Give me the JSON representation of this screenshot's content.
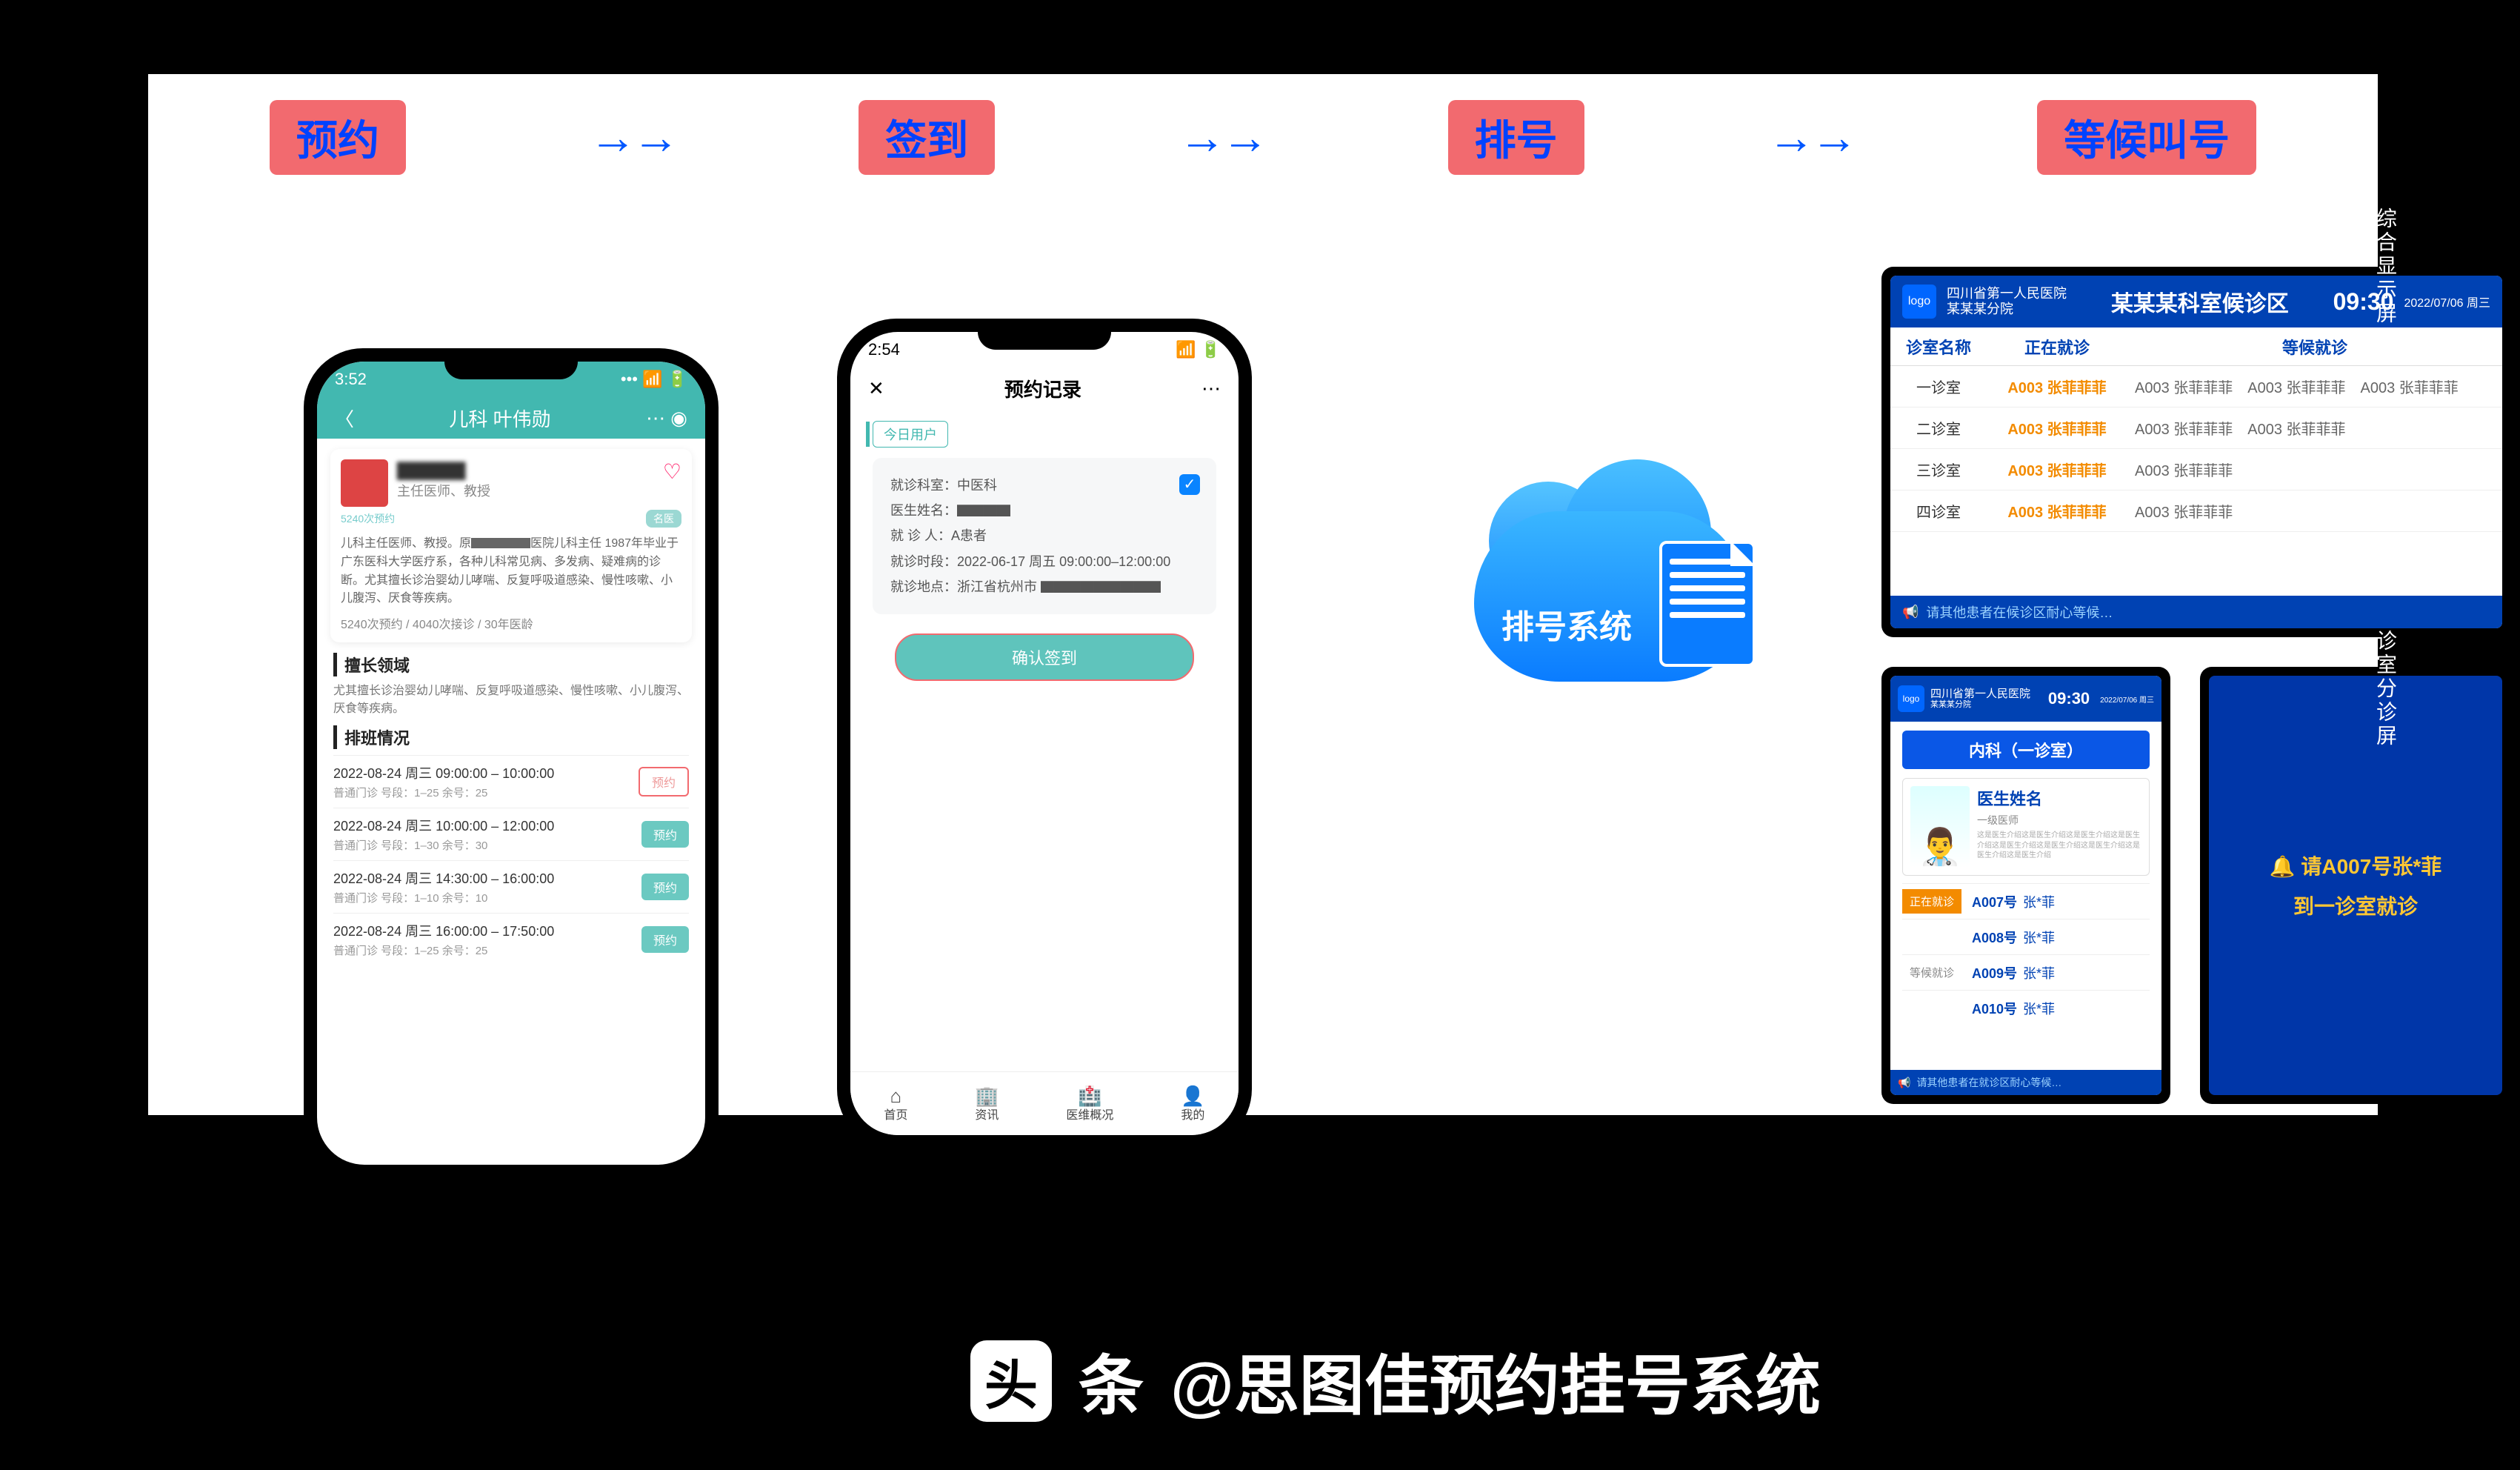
{
  "flow": {
    "steps": [
      "预约",
      "签到",
      "排号",
      "等候叫号"
    ],
    "arrow": "→→"
  },
  "phoneA": {
    "time": "3:52",
    "title": "儿科 叶伟勋",
    "card": {
      "name_masked": "主任医师、教授",
      "booked": "5240次预约",
      "tag": "名医",
      "bio": "儿科主任医师、教授。原▇▇▇▇▇医院儿科主任 1987年毕业于广东医科大学医疗系，各种儿科常见病、多发病、疑难病的诊断。尤其擅长诊治婴幼儿哮喘、反复呼吸道感染、慢性咳嗽、小儿腹泻、厌食等疾病。",
      "stats": "5240次预约 / 4040次接诊 / 30年医龄"
    },
    "expert_title": "擅长领域",
    "expert_body": "尤其擅长诊治婴幼儿哮喘、反复呼吸道感染、慢性咳嗽、小儿腹泻、厌食等疾病。",
    "sched_title": "排班情况",
    "slots": [
      {
        "line1": "2022-08-24  周三  09:00:00 – 10:00:00",
        "line2": "普通门诊 号段：1–25  余号：25",
        "btn": "预约",
        "sel": true
      },
      {
        "line1": "2022-08-24  周三  10:00:00 – 12:00:00",
        "line2": "普通门诊 号段：1–30  余号：30",
        "btn": "预约",
        "sel": false
      },
      {
        "line1": "2022-08-24  周三  14:30:00 – 16:00:00",
        "line2": "普通门诊 号段：1–10  余号：10",
        "btn": "预约",
        "sel": false
      },
      {
        "line1": "2022-08-24  周三  16:00:00 – 17:50:00",
        "line2": "普通门诊 号段：1–25  余号：25",
        "btn": "预约",
        "sel": false
      }
    ]
  },
  "phoneB": {
    "time": "2:54",
    "title": "预约记录",
    "tag": "今日用户",
    "rows": {
      "r1": "就诊科室：中医科",
      "r2": "医生姓名：▇▇▇▇",
      "r3": "就 诊 人：A患者",
      "r4": "就诊时段：2022-06-17 周五 09:00:00–12:00:00",
      "r5": "就诊地点：浙江省杭州市 ▇▇▇▇▇▇▇▇▇"
    },
    "confirm": "确认签到",
    "nav": [
      "首页",
      "资讯",
      "医维概况",
      "我的"
    ]
  },
  "cloud": {
    "label": "排号系统"
  },
  "wide": {
    "hospital": "四川省第一人民医院",
    "branch": "某某某分院",
    "area": "某某某科室候诊区",
    "time": "09:30",
    "date": "2022/07/06 周三",
    "th1": "诊室名称",
    "th2": "正在就诊",
    "th3": "等候就诊",
    "rows": [
      {
        "room": "一诊室",
        "now": "A003 张菲菲菲",
        "wait": [
          "A003 张菲菲菲",
          "A003 张菲菲菲",
          "A003 张菲菲菲"
        ]
      },
      {
        "room": "二诊室",
        "now": "A003 张菲菲菲",
        "wait": [
          "A003 张菲菲菲",
          "A003 张菲菲菲"
        ]
      },
      {
        "room": "三诊室",
        "now": "A003 张菲菲菲",
        "wait": [
          "A003 张菲菲菲"
        ]
      },
      {
        "room": "四诊室",
        "now": "A003 张菲菲菲",
        "wait": [
          "A003 张菲菲菲"
        ]
      }
    ],
    "foot": "请其他患者在候诊区耐心等候…"
  },
  "tall": {
    "hospital": "四川省第一人民医院",
    "branch": "某某某分院",
    "time": "09:30",
    "date": "2022/07/06 周三",
    "dept": "内科（一诊室）",
    "doc_name": "医生姓名",
    "doc_level": "一级医师",
    "doc_bio": "这是医生介绍这是医生介绍这是医生介绍这是医生介绍这是医生介绍这是医生介绍这是医生介绍这是医生介绍这是医生介绍",
    "now_tag": "正在就诊",
    "wait_tag": "等候就诊",
    "queue": [
      {
        "now": true,
        "num": "A007号",
        "name": "张*菲"
      },
      {
        "now": false,
        "num": "A008号",
        "name": "张*菲"
      },
      {
        "now": false,
        "num": "A009号",
        "name": "张*菲"
      },
      {
        "now": false,
        "num": "A010号",
        "name": "张*菲"
      }
    ],
    "foot": "请其他患者在就诊区耐心等候…"
  },
  "call": {
    "line1": "🔔 请A007号张*菲",
    "line2": "到一诊室就诊"
  },
  "vlabels": {
    "a": "综合显示屏",
    "b": "诊室分诊屏"
  },
  "footer": {
    "icon": "头",
    "icon_suffix": "条",
    "text": "@思图佳预约挂号系统"
  }
}
